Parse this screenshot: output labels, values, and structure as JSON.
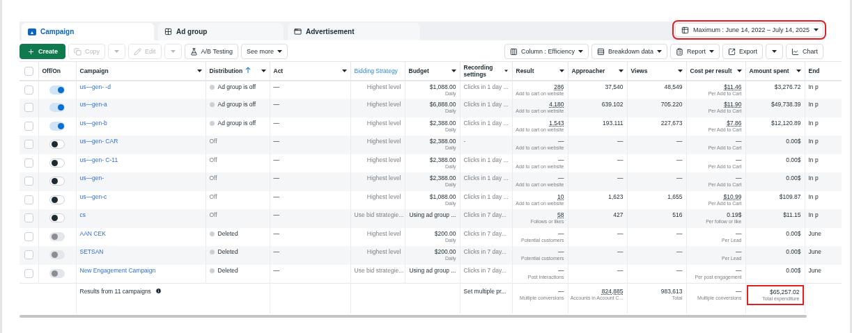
{
  "tabs": [
    {
      "label": "Campaign",
      "selected": true
    },
    {
      "label": "Ad group",
      "selected": false
    },
    {
      "label": "Advertisement",
      "selected": false
    }
  ],
  "date_range": {
    "label": "Maximum : June 14, 2022 – July 14, 2025",
    "highlighted": true
  },
  "toolbar_left": [
    {
      "kind": "primary",
      "label": "Create",
      "disabled": false
    },
    {
      "kind": "button",
      "label": "Copy",
      "disabled": true
    },
    {
      "kind": "caret",
      "disabled": true
    },
    {
      "kind": "button",
      "label": "Edit",
      "disabled": true
    },
    {
      "kind": "caret",
      "disabled": true
    },
    {
      "kind": "button",
      "label": "A/B Testing",
      "disabled": false
    },
    {
      "kind": "menu",
      "label": "See more",
      "disabled": false
    }
  ],
  "toolbar_right": [
    {
      "kind": "menu",
      "label": "Column : Efficiency",
      "disabled": false
    },
    {
      "kind": "menu",
      "label": "Breakdown data",
      "disabled": false
    },
    {
      "kind": "menu",
      "label": "Report",
      "disabled": false
    },
    {
      "kind": "button",
      "label": "Export",
      "disabled": false
    },
    {
      "kind": "caret",
      "disabled": false
    },
    {
      "kind": "button",
      "label": "Chart",
      "disabled": false
    }
  ],
  "columns": [
    {
      "label": "Off/On",
      "caret": false,
      "sorted": false,
      "active": false
    },
    {
      "label": "Campaign",
      "caret": true,
      "sorted": false,
      "active": false
    },
    {
      "label": "Distribution",
      "caret": true,
      "sorted": true,
      "active": false
    },
    {
      "label": "Act",
      "caret": true,
      "sorted": false,
      "active": false
    },
    {
      "label": "Bidding Strategy",
      "caret": false,
      "sorted": false,
      "active": true
    },
    {
      "label": "Budget",
      "caret": true,
      "sorted": false,
      "active": false
    },
    {
      "label": "Recording settings",
      "caret": true,
      "sorted": false,
      "active": false
    },
    {
      "label": "Result",
      "caret": true,
      "sorted": false,
      "active": false
    },
    {
      "label": "Approacher",
      "caret": true,
      "sorted": false,
      "active": false
    },
    {
      "label": "Views",
      "caret": true,
      "sorted": false,
      "active": false
    },
    {
      "label": "Cost per result",
      "caret": true,
      "sorted": false,
      "active": false
    },
    {
      "label": "Amount spent",
      "caret": true,
      "sorted": false,
      "active": false
    },
    {
      "label": "End",
      "caret": false,
      "sorted": false,
      "active": false
    }
  ],
  "select_all": {
    "checked": false
  },
  "rows": [
    {
      "checked": false,
      "on": true,
      "disabled": false,
      "campaign": "us—gen- -d",
      "distribution": {
        "text": "Ad group is off",
        "dot": true
      },
      "act": "—",
      "bidding": "Highest level",
      "budget": {
        "value": "$1,088.00",
        "sub": "Daily"
      },
      "recording": "Clicks in 1 day ...",
      "result": {
        "value": "286",
        "label": "Add to cart on website",
        "link": true
      },
      "approacher": "37,540",
      "views": "48,549",
      "cost": {
        "value": "$11.46",
        "label": "Per Add to Cart",
        "link": true
      },
      "spent": "$3,276.72",
      "end": "In p"
    },
    {
      "checked": false,
      "on": true,
      "disabled": false,
      "campaign": "us—gen-a",
      "distribution": {
        "text": "Ad group is off",
        "dot": true
      },
      "act": "—",
      "bidding": "Highest level",
      "budget": {
        "value": "$6,888.00",
        "sub": "Daily"
      },
      "recording": "Clicks in 1 day ...",
      "result": {
        "value": "4.180",
        "label": "Add to cart on website",
        "link": true
      },
      "approacher": "639.102",
      "views": "705.220",
      "cost": {
        "value": "$11.90",
        "label": "Per Add to Cart",
        "link": true
      },
      "spent": "$49,738.39",
      "end": "In p"
    },
    {
      "checked": false,
      "on": true,
      "disabled": false,
      "campaign": "us—gen-b",
      "distribution": {
        "text": "Ad group is off",
        "dot": true
      },
      "act": "—",
      "bidding": "Highest level",
      "budget": {
        "value": "$2,388.00",
        "sub": "Daily"
      },
      "recording": "Clicks in 1 day ...",
      "result": {
        "value": "1.543",
        "label": "Add to cart on website",
        "link": true
      },
      "approacher": "193.111",
      "views": "227,673",
      "cost": {
        "value": "$7.86",
        "label": "Per Add to Cart",
        "link": true
      },
      "spent": "$12,120.89",
      "end": "In p"
    },
    {
      "checked": false,
      "on": false,
      "disabled": false,
      "campaign": "us—gen- CAR",
      "distribution": {
        "text": "Off",
        "dot": false
      },
      "act": "—",
      "bidding": "Highest level",
      "budget": {
        "value": "$2,388.00",
        "sub": "Daily"
      },
      "recording": "-",
      "result": {
        "value": "—",
        "label": "Add to cart on website",
        "link": false
      },
      "approacher": "—",
      "views": "—",
      "cost": {
        "value": "—",
        "label": "Per Add to Cart",
        "link": false
      },
      "spent": "0.00$",
      "end": "In p"
    },
    {
      "checked": false,
      "on": false,
      "disabled": false,
      "campaign": "us—gen- C-11",
      "distribution": {
        "text": "Off",
        "dot": false
      },
      "act": "—",
      "bidding": "Highest level",
      "budget": {
        "value": "$2,388.00",
        "sub": "Daily"
      },
      "recording": "Clicks in 1 day ...",
      "result": {
        "value": "—",
        "label": "Add to cart on website",
        "link": false
      },
      "approacher": "—",
      "views": "—",
      "cost": {
        "value": "—",
        "label": "Per Add to Cart",
        "link": false
      },
      "spent": "0.00$",
      "end": "In p"
    },
    {
      "checked": false,
      "on": false,
      "disabled": false,
      "campaign": "us—gen-",
      "distribution": {
        "text": "Off",
        "dot": false
      },
      "act": "—",
      "bidding": "Highest level",
      "budget": {
        "value": "$2,388.00",
        "sub": "Daily"
      },
      "recording": "Clicks in 1 day ...",
      "result": {
        "value": "—",
        "label": "Add to cart on website",
        "link": false
      },
      "approacher": "—",
      "views": "—",
      "cost": {
        "value": "—",
        "label": "Per Add to Cart",
        "link": false
      },
      "spent": "0.00$",
      "end": "In p"
    },
    {
      "checked": false,
      "on": false,
      "disabled": false,
      "campaign": "us—gen-c",
      "distribution": {
        "text": "Off",
        "dot": false
      },
      "act": "—",
      "bidding": "Highest level",
      "budget": {
        "value": "$1,088.00",
        "sub": "Daily"
      },
      "recording": "Clicks in 1 day ...",
      "result": {
        "value": "10",
        "label": "Add to cart on website",
        "link": true
      },
      "approacher": "1,623",
      "views": "1,655",
      "cost": {
        "value": "$10.99",
        "label": "Per Add to Cart",
        "link": true
      },
      "spent": "$109.87",
      "end": "In p"
    },
    {
      "checked": false,
      "on": false,
      "disabled": false,
      "campaign": "cs",
      "distribution": {
        "text": "Off",
        "dot": false
      },
      "act": "—",
      "bidding": "Use bid strategie...",
      "budget": {
        "value": "Using ad group ..."
      },
      "recording": "Clicks in 7 day...",
      "result": {
        "value": "58",
        "label": "Follows or likes",
        "link": true
      },
      "approacher": "427",
      "views": "516",
      "cost": {
        "value": "0.19$",
        "label": "Per follow or like",
        "link": false
      },
      "spent": "$11.15",
      "end": "In p"
    },
    {
      "checked": false,
      "on": false,
      "disabled": true,
      "campaign": "AAN CEK",
      "distribution": {
        "text": "Deleted",
        "dot": true
      },
      "act": "—",
      "bidding": "Highest level",
      "budget": {
        "value": "$200.00",
        "sub": "Daily"
      },
      "recording": "Clicks in 7 day...",
      "result": {
        "value": "—",
        "label": "Potential customers",
        "link": false
      },
      "approacher": "—",
      "views": "—",
      "cost": {
        "value": "—",
        "label": "Per Lead",
        "link": false
      },
      "spent": "0.00$",
      "end": "June"
    },
    {
      "checked": false,
      "on": false,
      "disabled": true,
      "campaign": "SETSAN",
      "distribution": {
        "text": "Deleted",
        "dot": true
      },
      "act": "—",
      "bidding": "Highest level",
      "budget": {
        "value": "$200.00",
        "sub": "Daily"
      },
      "recording": "Clicks in 7 day...",
      "result": {
        "value": "—",
        "label": "Potential customers",
        "link": false
      },
      "approacher": "—",
      "views": "—",
      "cost": {
        "value": "—",
        "label": "Per Lead",
        "link": false
      },
      "spent": "0.00$",
      "end": "June"
    },
    {
      "checked": false,
      "on": false,
      "disabled": true,
      "campaign": "New Engagement Campaign",
      "distribution": {
        "text": "Deleted",
        "dot": true
      },
      "act": "—",
      "bidding": "Use bid strategie...",
      "budget": {
        "value": "Using ad group ..."
      },
      "recording": "Clicks in 7 day...",
      "result": {
        "value": "—",
        "label": "Post interactions",
        "link": false
      },
      "approacher": "—",
      "views": "—",
      "cost": {
        "value": "—",
        "label": "Per post engagement",
        "link": false
      },
      "spent": "0.00$",
      "end": "June"
    }
  ],
  "totals": {
    "campaign": "Results from 11 campaigns",
    "recording": "Set multiple pr...",
    "result": {
      "value": "—",
      "label": "Multiple conversions",
      "link": false
    },
    "approacher": {
      "value": "824,885",
      "label": "Accounts in Account C...",
      "link": true
    },
    "views": {
      "value": "983,613",
      "label": "Total",
      "link": false
    },
    "cost": {
      "value": "—",
      "label": "Multiple conversions",
      "link": false
    },
    "spent": {
      "value": "$65,257.02",
      "label": "Total expenditure",
      "link": false,
      "highlighted": true
    }
  }
}
